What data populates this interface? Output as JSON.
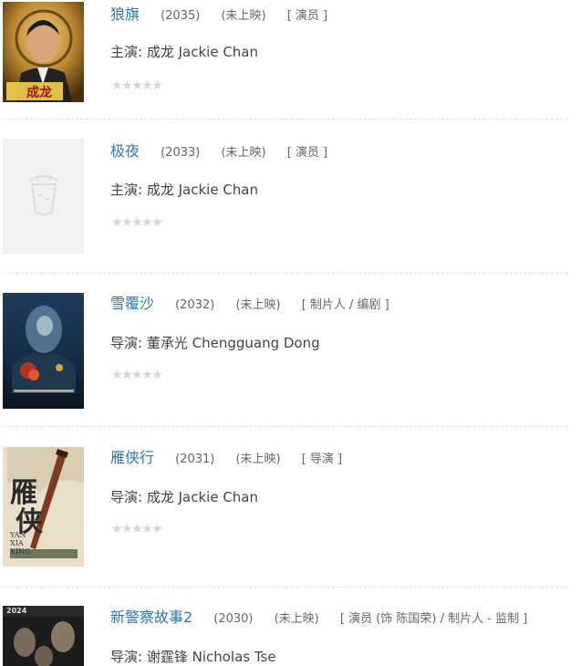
{
  "items": [
    {
      "title": "狼旗",
      "year": "(2035)",
      "status": "(未上映)",
      "roles": "[ 演员 ]",
      "credit_label": "主演:",
      "credit_name": "成龙 Jackie Chan",
      "stars": "★★★★★",
      "poster_text": "成龙"
    },
    {
      "title": "极夜",
      "year": "(2033)",
      "status": "(未上映)",
      "roles": "[ 演员 ]",
      "credit_label": "主演:",
      "credit_name": "成龙 Jackie Chan",
      "stars": "★★★★★"
    },
    {
      "title": "雪覆沙",
      "year": "(2032)",
      "status": "(未上映)",
      "roles": "[ 制片人 / 编剧 ]",
      "credit_label": "导演:",
      "credit_name": "董承光 Chengguang Dong",
      "stars": "★★★★★"
    },
    {
      "title": "雁侠行",
      "year": "(2031)",
      "status": "(未上映)",
      "roles": "[ 导演 ]",
      "credit_label": "导演:",
      "credit_name": "成龙 Jackie Chan",
      "stars": "★★★★★",
      "poster_text": "YAN XIA XING"
    },
    {
      "title": "新警察故事2",
      "year": "(2030)",
      "status": "(未上映)",
      "roles": "[ 演员 (饰 陈国荣) / 制片人 - 监制 ]",
      "credit_label": "导演:",
      "credit_name": "谢霆锋 Nicholas Tse",
      "poster_text": "2024"
    }
  ]
}
